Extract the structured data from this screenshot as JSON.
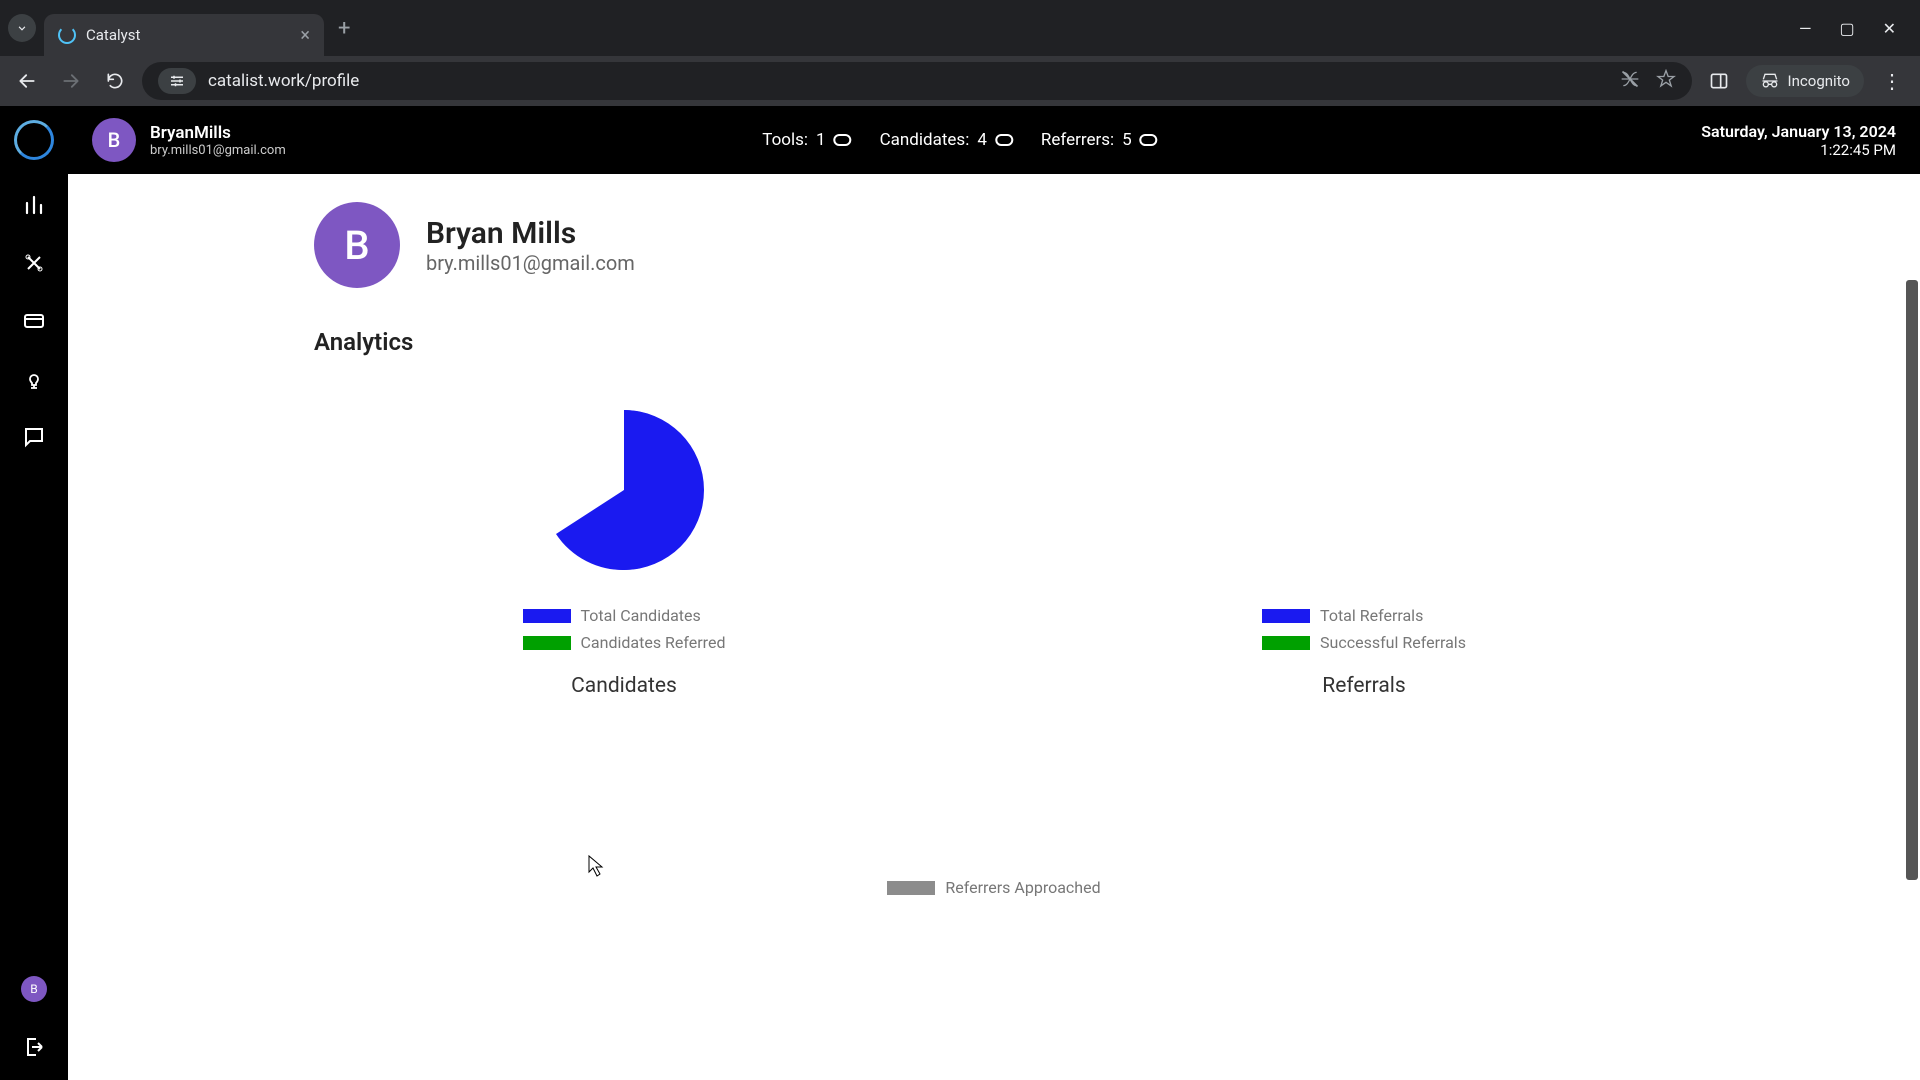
{
  "browser": {
    "tab_title": "Catalyst",
    "url": "catalist.work/profile",
    "incognito_label": "Incognito"
  },
  "header": {
    "avatar_letter": "B",
    "username": "BryanMills",
    "email": "bry.mills01@gmail.com",
    "stats": {
      "tools_label": "Tools:",
      "tools_count": "1",
      "candidates_label": "Candidates:",
      "candidates_count": "4",
      "referrers_label": "Referrers:",
      "referrers_count": "5"
    },
    "date": "Saturday, January 13, 2024",
    "time": "1:22:45 PM"
  },
  "profile": {
    "avatar_letter": "B",
    "name": "Bryan Mills",
    "email": "bry.mills01@gmail.com"
  },
  "analytics": {
    "title": "Analytics",
    "candidates": {
      "title": "Candidates",
      "legend": [
        {
          "label": "Total Candidates",
          "color": "#1a1af0"
        },
        {
          "label": "Candidates Referred",
          "color": "#00a000"
        }
      ]
    },
    "referrals": {
      "title": "Referrals",
      "legend": [
        {
          "label": "Total Referrals",
          "color": "#1a1af0"
        },
        {
          "label": "Successful Referrals",
          "color": "#00a000"
        }
      ]
    },
    "referrers": {
      "legend": [
        {
          "label": "Referrers Approached",
          "color": "#8c8c8c"
        }
      ]
    }
  },
  "chart_data": [
    {
      "type": "pie",
      "title": "Candidates",
      "series": [
        {
          "name": "Total Candidates",
          "values": [
            4
          ]
        },
        {
          "name": "Candidates Referred",
          "values": [
            0
          ]
        }
      ]
    },
    {
      "type": "pie",
      "title": "Referrals",
      "series": [
        {
          "name": "Total Referrals",
          "values": [
            0
          ]
        },
        {
          "name": "Successful Referrals",
          "values": [
            0
          ]
        }
      ]
    }
  ],
  "colors": {
    "avatar_bg": "#7e57c2",
    "chart_blue": "#1a1af0",
    "chart_green": "#00a000",
    "chart_grey": "#8c8c8c"
  }
}
